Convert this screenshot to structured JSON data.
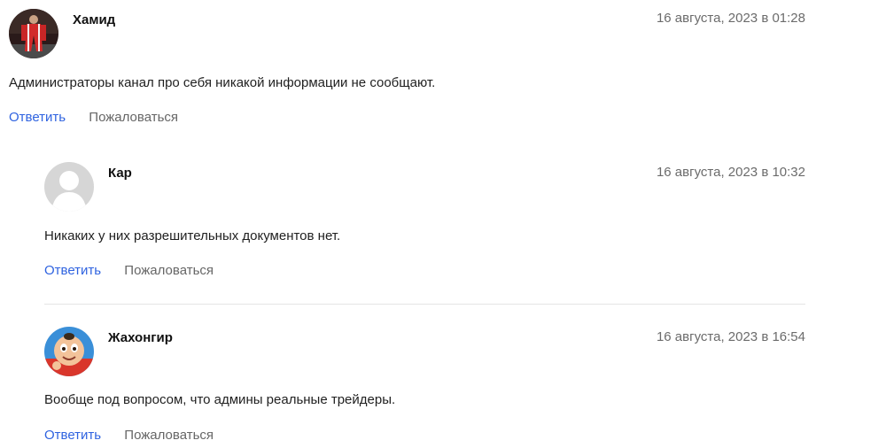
{
  "comments": [
    {
      "author": "Хамид",
      "date": "16 августа, 2023 в 01:28",
      "text": "Администраторы канал про себя никакой информации не сообщают.",
      "reply_label": "Ответить",
      "report_label": "Пожаловаться"
    },
    {
      "author": "Кар",
      "date": "16 августа, 2023 в 10:32",
      "text": "Никаких у них разрешительных документов нет.",
      "reply_label": "Ответить",
      "report_label": "Пожаловаться"
    },
    {
      "author": "Жахонгир",
      "date": "16 августа, 2023 в 16:54",
      "text": "Вообще под вопросом, что админы реальные трейдеры.",
      "reply_label": "Ответить",
      "report_label": "Пожаловаться"
    }
  ],
  "colors": {
    "link": "#2f63e0",
    "secondary": "#666666",
    "divider": "#e4e4e4"
  }
}
